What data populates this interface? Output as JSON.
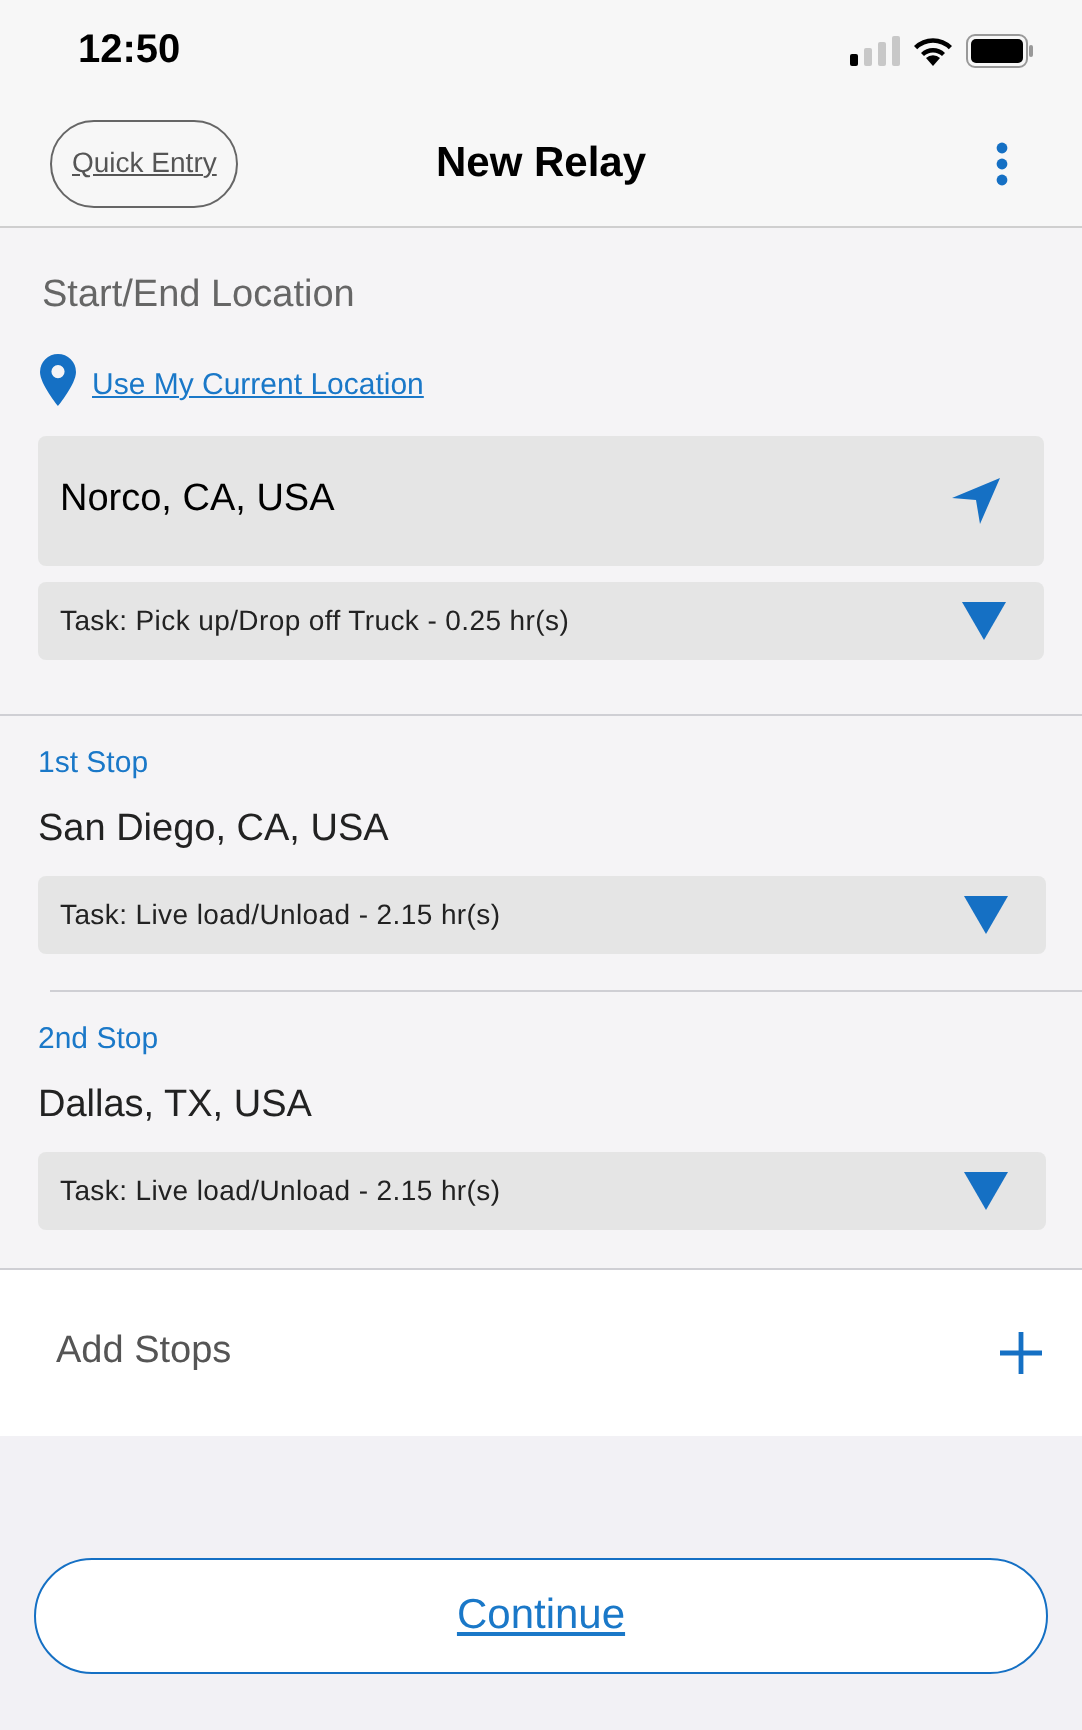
{
  "status_bar": {
    "time": "12:50"
  },
  "nav": {
    "left_button": "Quick Entry",
    "title": "New Relay"
  },
  "start_end": {
    "heading": "Start/End Location",
    "current_location_link": "Use My Current Location",
    "location": "Norco, CA, USA",
    "task": "Task: Pick up/Drop off Truck - 0.25 hr(s)"
  },
  "stops": [
    {
      "label": "1st Stop",
      "location": "San Diego, CA, USA",
      "task": "Task: Live load/Unload - 2.15 hr(s)"
    },
    {
      "label": "2nd Stop",
      "location": "Dallas, TX, USA",
      "task": "Task: Live load/Unload - 2.15 hr(s)"
    }
  ],
  "add_stops": {
    "label": "Add Stops"
  },
  "continue_button": "Continue"
}
